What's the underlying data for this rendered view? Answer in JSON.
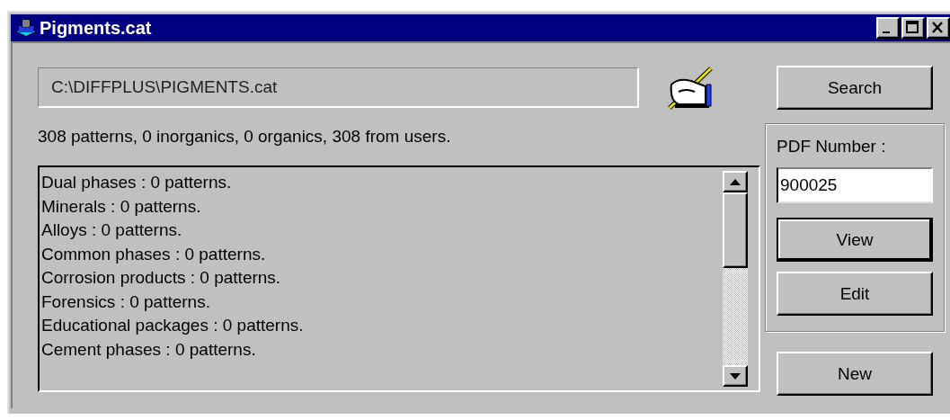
{
  "window": {
    "title": "Pigments.cat"
  },
  "catalog_path": "C:\\DIFFPLUS\\PIGMENTS.cat",
  "summary": "308 patterns, 0 inorganics, 0 organics, 308 from users.",
  "categories": [
    "Dual phases : 0 patterns.",
    "Minerals : 0 patterns.",
    "Alloys : 0 patterns.",
    "Common phases : 0 patterns.",
    "Corrosion products : 0 patterns.",
    "Forensics : 0 patterns.",
    "Educational packages : 0 patterns.",
    "Cement phases : 0 patterns."
  ],
  "search_button": {
    "label": "Search",
    "default": false
  },
  "pdf_group": {
    "label": "PDF Number :",
    "value": "900025",
    "buttons": [
      {
        "label": "View",
        "default": true
      },
      {
        "label": "Edit",
        "default": false
      }
    ]
  },
  "new_button": {
    "label": "New",
    "default": false
  }
}
